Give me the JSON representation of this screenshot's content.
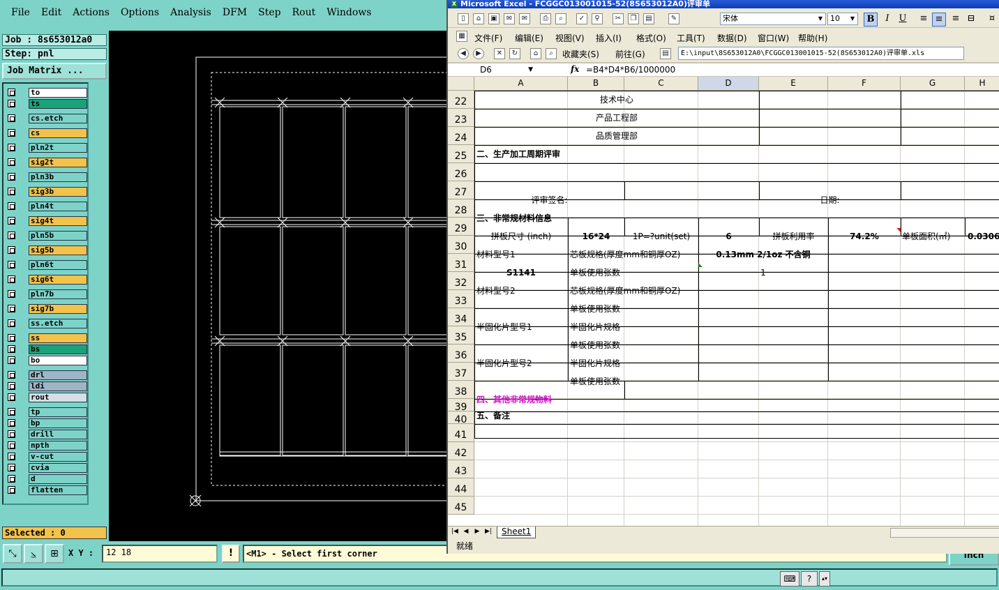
{
  "cam": {
    "menu": [
      "File",
      "Edit",
      "Actions",
      "Options",
      "Analysis",
      "DFM",
      "Step",
      "Rout",
      "Windows"
    ],
    "job_label": "Job : 8s653012a0",
    "step_label": "Step: pnl",
    "job_matrix_button": "Job Matrix ...",
    "layers": [
      {
        "name": "to",
        "color": "#ffffff"
      },
      {
        "name": "ts",
        "color": "#1aa37a"
      },
      {
        "name": "cs.etch",
        "color": "#7ed3c9"
      },
      {
        "name": "cs",
        "color": "#f3c24b"
      },
      {
        "name": "pln2t",
        "color": "#7ed3c9"
      },
      {
        "name": "sig2t",
        "color": "#f3c24b"
      },
      {
        "name": "pln3b",
        "color": "#7ed3c9"
      },
      {
        "name": "sig3b",
        "color": "#f3c24b"
      },
      {
        "name": "pln4t",
        "color": "#7ed3c9"
      },
      {
        "name": "sig4t",
        "color": "#f3c24b"
      },
      {
        "name": "pln5b",
        "color": "#7ed3c9"
      },
      {
        "name": "sig5b",
        "color": "#f3c24b"
      },
      {
        "name": "pln6t",
        "color": "#7ed3c9"
      },
      {
        "name": "sig6t",
        "color": "#f3c24b"
      },
      {
        "name": "pln7b",
        "color": "#7ed3c9"
      },
      {
        "name": "sig7b",
        "color": "#f3c24b"
      },
      {
        "name": "ss.etch",
        "color": "#7ed3c9"
      },
      {
        "name": "ss",
        "color": "#f3c24b"
      },
      {
        "name": "bs",
        "color": "#1aa37a"
      },
      {
        "name": "bo",
        "color": "#ffffff"
      },
      {
        "name": "drl",
        "color": "#9fb4c4"
      },
      {
        "name": "ldi",
        "color": "#9fb4c4"
      },
      {
        "name": "rout",
        "color": "#d6dfe6"
      },
      {
        "name": "tp",
        "color": "#7ed3c9"
      },
      {
        "name": "bp",
        "color": "#7ed3c9"
      },
      {
        "name": "drill",
        "color": "#7ed3c9"
      },
      {
        "name": "npth",
        "color": "#7ed3c9"
      },
      {
        "name": "v-cut",
        "color": "#7ed3c9"
      },
      {
        "name": "cvia",
        "color": "#7ed3c9"
      },
      {
        "name": "d",
        "color": "#7ed3c9"
      },
      {
        "name": "flatten",
        "color": "#7ed3c9"
      }
    ],
    "selected_label": "Selected : 0",
    "xy_label": "X Y :",
    "xy_value": "12  18",
    "alert_symbol": "!",
    "prompt": "<M1> - Select first corner",
    "unit_button": "Inch"
  },
  "excel": {
    "title": "Microsoft Excel - FCGGC013001015-52(8S653012A0)评审单",
    "font_name": "宋体",
    "font_size": "10",
    "menu": [
      "文件(F)",
      "编辑(E)",
      "视图(V)",
      "插入(I)",
      "格式(O)",
      "工具(T)",
      "数据(D)",
      "窗口(W)",
      "帮助(H)"
    ],
    "favorites_label": "收藏夹(S)",
    "goto_label": "前往(G)",
    "path": "E:\\input\\8S653012A0\\FCGGC013001015-52(8S653012A0)评审单.xls",
    "name_box": "D6",
    "fx_label": "fx",
    "formula": "=B4*D4*B6/1000000",
    "columns": [
      "A",
      "B",
      "C",
      "D",
      "E",
      "F",
      "G",
      "H"
    ],
    "rows": [
      "22",
      "23",
      "24",
      "25",
      "26",
      "27",
      "28",
      "29",
      "30",
      "31",
      "32",
      "33",
      "34",
      "35",
      "36",
      "37",
      "38",
      "39",
      "40",
      "41",
      "42",
      "43",
      "44",
      "45"
    ],
    "cells": {
      "r22_b": "技术中心",
      "r23_b": "产品工程部",
      "r24_b": "品质管理部",
      "r25_a": "二、生产加工周期评审",
      "r27_a": "评审签名:",
      "r27_e": "日期:",
      "r28_a": "三、非常规材料信息",
      "r29_a": "拼板尺寸 (inch)",
      "r29_b": "16*24",
      "r29_c": "1P=?unit(set)",
      "r29_d": "6",
      "r29_e": "拼板利用率",
      "r29_f": "74.2%",
      "r29_g": "单板面积(㎡)",
      "r29_h": "0.0306",
      "r30_a": "材料型号1",
      "r30_b": "芯板规格(厚度mm和铜厚OZ)",
      "r30_d": "0.13mm 2/1oz 不含铜",
      "r31_a": "S1141",
      "r31_b": "单板使用张数",
      "r31_d": "1",
      "r32_a": "材料型号2",
      "r32_b": "芯板规格(厚度mm和铜厚OZ)",
      "r33_b": "单板使用张数",
      "r34_a": "半固化片型号1",
      "r34_b": "半固化片规格",
      "r35_b": "单板使用张数",
      "r36_a": "半固化片型号2",
      "r36_b": "半固化片规格",
      "r37_b": "单板使用张数",
      "r38_a": "四、其他非常规物料",
      "r39_a": "五、备注"
    },
    "sheet_tab": "Sheet1",
    "status": "就绪"
  }
}
